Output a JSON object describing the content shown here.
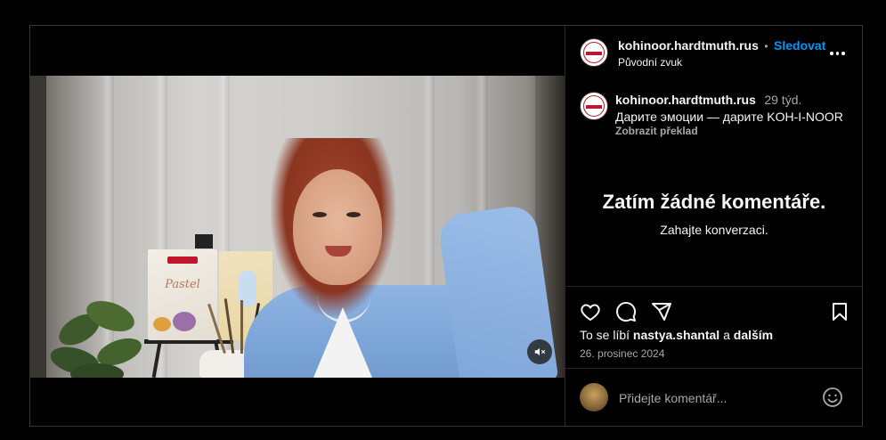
{
  "post": {
    "username": "kohinoor.hardtmuth.rus",
    "follow_label": "Sledovat",
    "separator": "•",
    "audio_label": "Původní zvuk"
  },
  "caption": {
    "username": "kohinoor.hardtmuth.rus",
    "time_ago": "29 týd.",
    "text": "Дарите эмоции — дарите KOH-I-NOOR",
    "translate_label": "Zobrazit překlad"
  },
  "comments": {
    "empty_title": "Zatím žádné komentáře.",
    "empty_subtitle": "Zahajte konverzaci."
  },
  "likes": {
    "prefix": "To se líbí",
    "user": "nastya.shantal",
    "connector": "a",
    "others": "dalším"
  },
  "date": "26. prosinec 2024",
  "add_comment": {
    "placeholder": "Přidejte komentář..."
  },
  "video": {
    "pencil_box_label": "Pastel"
  },
  "icons": {
    "more": "more-horizontal-icon",
    "mute": "speaker-muted-icon",
    "like": "heart-icon",
    "comment": "comment-bubble-icon",
    "share": "paper-plane-icon",
    "save": "bookmark-icon",
    "emoji": "smiley-icon"
  },
  "colors": {
    "background": "#000000",
    "border": "#363636",
    "accent": "#0095f6",
    "secondary_text": "#a8a8a8",
    "brand_red": "#c0162b"
  }
}
